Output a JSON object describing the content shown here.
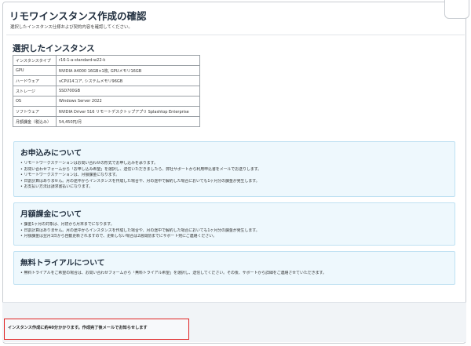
{
  "page": {
    "title": "リモワインスタンス作成の確認",
    "subtitle": "選択したインスタンス仕様および契約内容を確認してください。"
  },
  "selected": {
    "title": "選択したインスタンス",
    "rows": [
      {
        "key": "インスタンスタイプ",
        "value": "r16-1-a-standard-w22-k"
      },
      {
        "key": "GPU",
        "value": "NVIDIA A4000 16GB×1枚, GPUメモリ16GB"
      },
      {
        "key": "ハードウェア",
        "value": "vCPU14コア, システムメモリ96GB"
      },
      {
        "key": "ストレージ",
        "value": "SSD700GB"
      },
      {
        "key": "OS",
        "value": "Windows Server 2022"
      },
      {
        "key": "ソフトウェア",
        "value": "NVIDIA Driver 516 リモートデスクトップアプリ Splashtop Enterprise"
      },
      {
        "key": "月額課金（税込み）",
        "value": "54,450円/月"
      }
    ]
  },
  "sections": {
    "apply": {
      "title": "お申込みについて",
      "items": [
        "リモートワークステーションはお問い合わせの形式でお申し込みを承ります。",
        "お問い合わせフォームから「お申し込み希望」を選択し、送信いただきましたら、弊社サポートから利用申込書をメールでお送りします。",
        "リモートワークステーションは、月額課金になります。",
        "日割計算はありません。月の途中からインスタンスを作成した場合や、月の途中で解約した場合においても1ヶ月分の課金が発生します。",
        "お支払い方法は請求書払いになります。"
      ]
    },
    "billing": {
      "title": "月額課金について",
      "items": [
        "課金1ヶ月の対象は、月初から月末までになります。",
        "日割計算はありません。月の途中からインスタンスを作成した場合や、月の途中で解約した場合においても1ヶ月分の課金が発生します。",
        "月額課金は翌月1日から自動更新されますので、更新しない場合は2週間前までにサポート宛にご連絡ください。"
      ]
    },
    "trial": {
      "title": "無料トライアルについて",
      "items": [
        "無料トライアルをご希望の場合は、お問い合わせフォームから「無料トライアル希望」を選択し、送信してください。その後、サポートから詳細をご連絡させていただきます。"
      ]
    }
  },
  "footer": {
    "notice": "インスタンス作成に約40分かかります。作成完了後メールでお知らせします"
  },
  "colors": {
    "panel_bg": "#eef8fd",
    "panel_border": "#bfe1f2",
    "notice_border": "#e02222"
  }
}
